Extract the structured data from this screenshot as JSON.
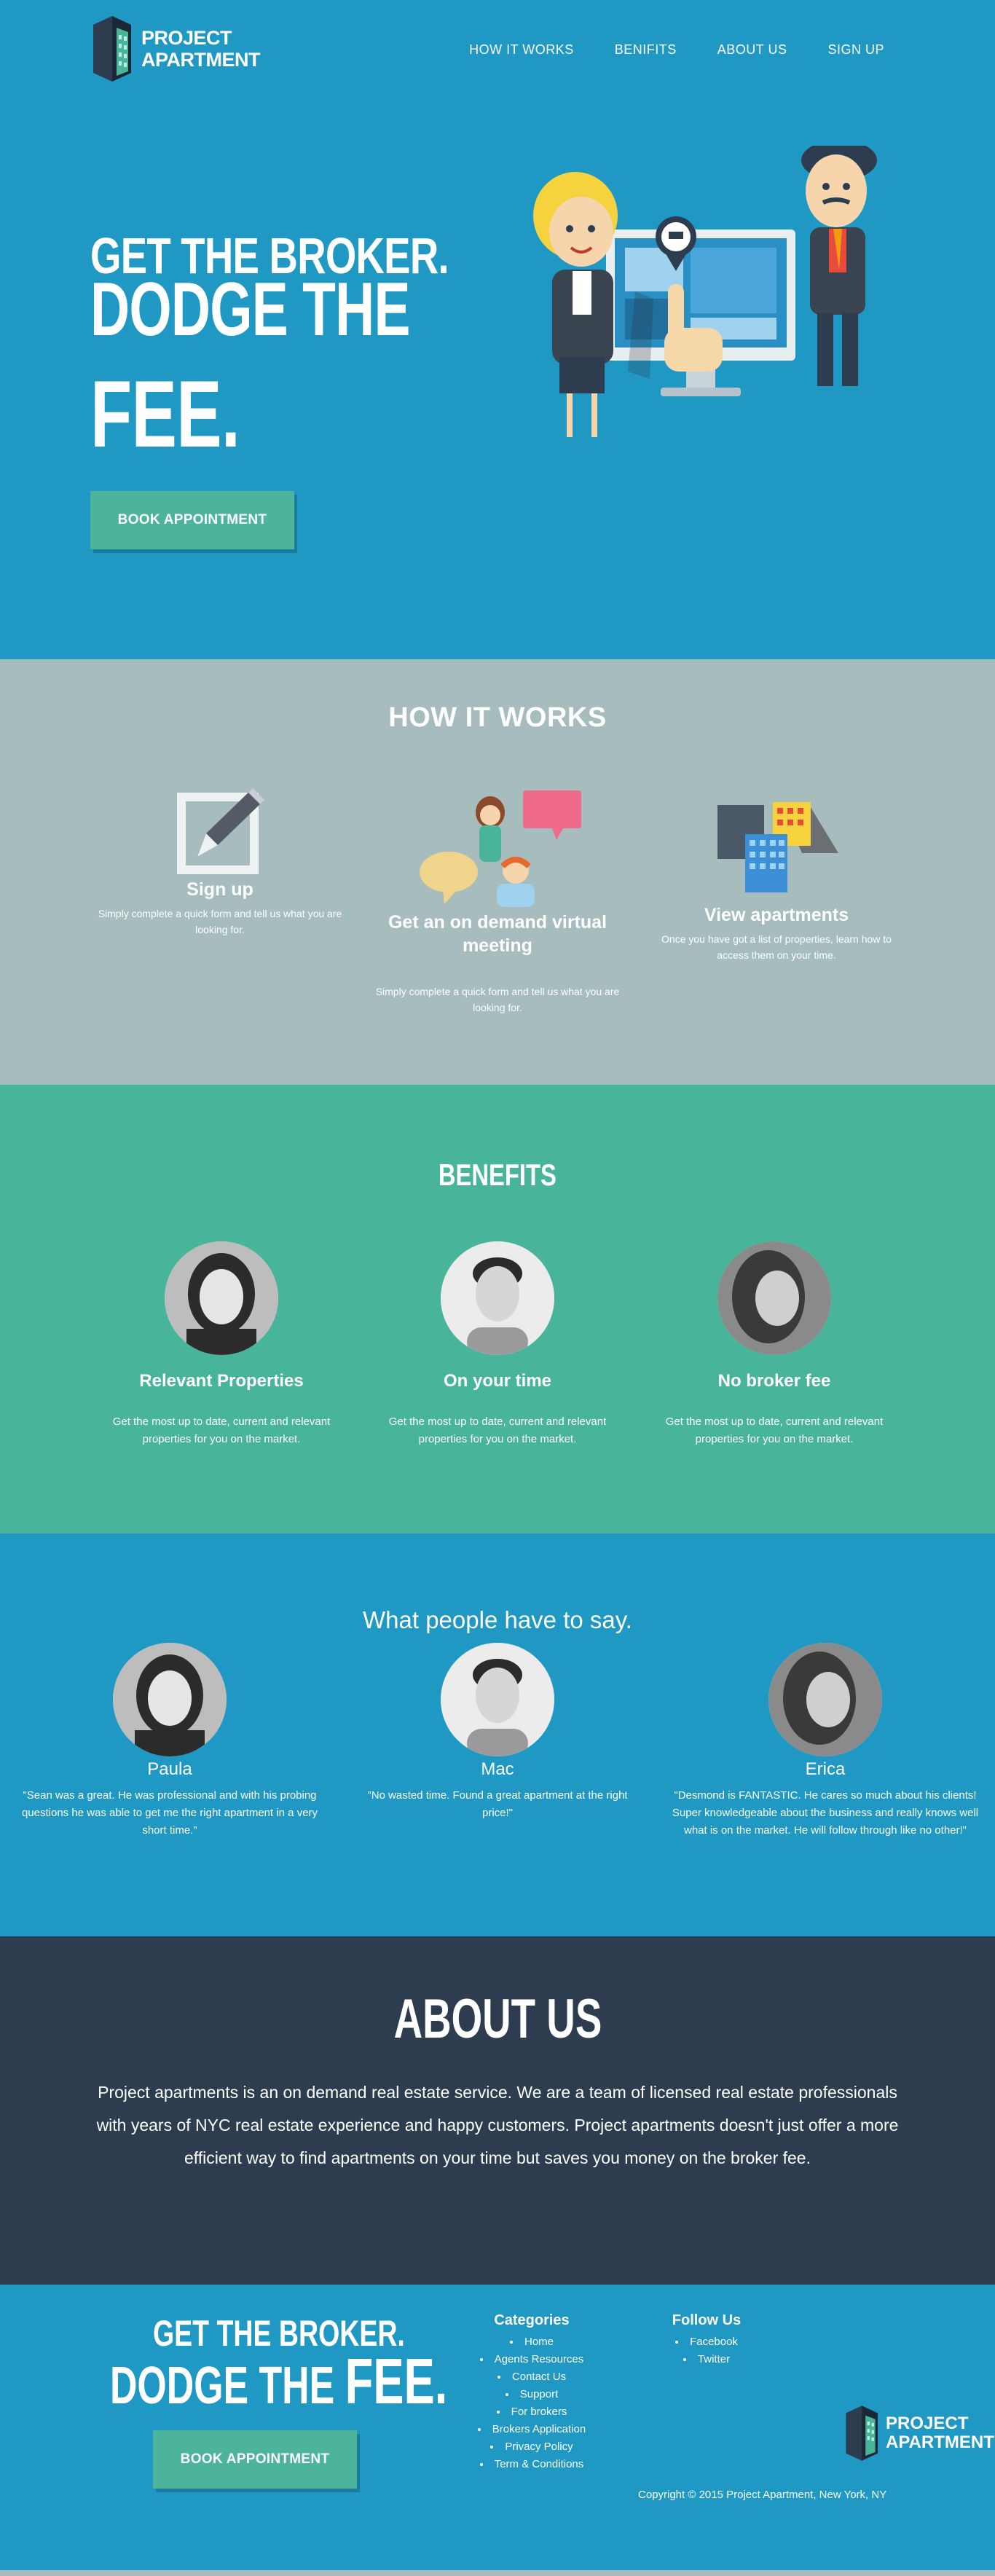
{
  "brand": {
    "line1": "PROJECT",
    "line2": "APARTMENT"
  },
  "nav": {
    "items": [
      "HOW IT WORKS",
      "BENIFITS",
      "ABOUT US",
      "SIGN UP"
    ]
  },
  "hero": {
    "line1": "GET THE BROKER.",
    "line2": "DODGE THE",
    "line3": "FEE.",
    "cta": "BOOK APPOINTMENT"
  },
  "how": {
    "title": "HOW IT WORKS",
    "steps": [
      {
        "title": "Sign up",
        "text": "Simply complete a quick form and tell us what you are looking for.",
        "icon": "checkbox-pencil-icon"
      },
      {
        "title": "Get an on demand virtual meeting",
        "text": "Simply complete a quick form and tell us what you are looking for.",
        "icon": "virtual-meeting-icon"
      },
      {
        "title": "View apartments",
        "text": "Once you have got a list of properties, learn how to access them on your time.",
        "icon": "buildings-icon"
      }
    ]
  },
  "benefits": {
    "title": "BENEFITS",
    "items": [
      {
        "title": "Relevant Properties",
        "text": "Get the most up to date, current and relevant properties for you on the market."
      },
      {
        "title": "On your time",
        "text": "Get the most up to date, current and relevant properties for you on the market."
      },
      {
        "title": "No broker fee",
        "text": "Get the most up to date, current and relevant properties for you on the market."
      }
    ]
  },
  "testimonials": {
    "title": "What people have to say.",
    "people": [
      {
        "name": "Paula",
        "quote": "\"Sean was a great. He was professional and with his probing questions he was able to get me the right apartment in a very short time.\""
      },
      {
        "name": "Mac",
        "quote": "\"No wasted time. Found a great apartment at the right price!\""
      },
      {
        "name": "Erica",
        "quote": "\"Desmond is FANTASTIC. He cares so much about his clients! Super knowledgeable about the business and really knows well what is on the market. He will follow through like no other!\""
      }
    ]
  },
  "about": {
    "title": "ABOUT US",
    "text": "Project apartments is an on demand real estate service. We are a team of licensed real estate professionals with years of NYC real estate experience and happy customers. Project apartments doesn't just offer a more efficient way to find apartments on your time but saves you money on the broker fee."
  },
  "footer": {
    "line1": "GET THE BROKER.",
    "line2a": "DODGE THE ",
    "line2b": "FEE.",
    "cta": "BOOK APPOINTMENT",
    "categories_title": "Categories",
    "categories": [
      "Home",
      "Agents Resources",
      "Contact Us",
      "Support",
      "For brokers",
      "Brokers Application",
      "Privacy Policy",
      "Term & Conditions"
    ],
    "follow_title": "Follow Us",
    "follow": [
      "Facebook",
      "Twitter"
    ],
    "copyright": "Copyright © 2015 Project Apartment, New York, NY"
  },
  "colors": {
    "blue": "#1f98c4",
    "teal": "#48b49a",
    "gray": "#a6bcbd",
    "navy": "#2d3d4f",
    "button": "#4bb49b"
  }
}
